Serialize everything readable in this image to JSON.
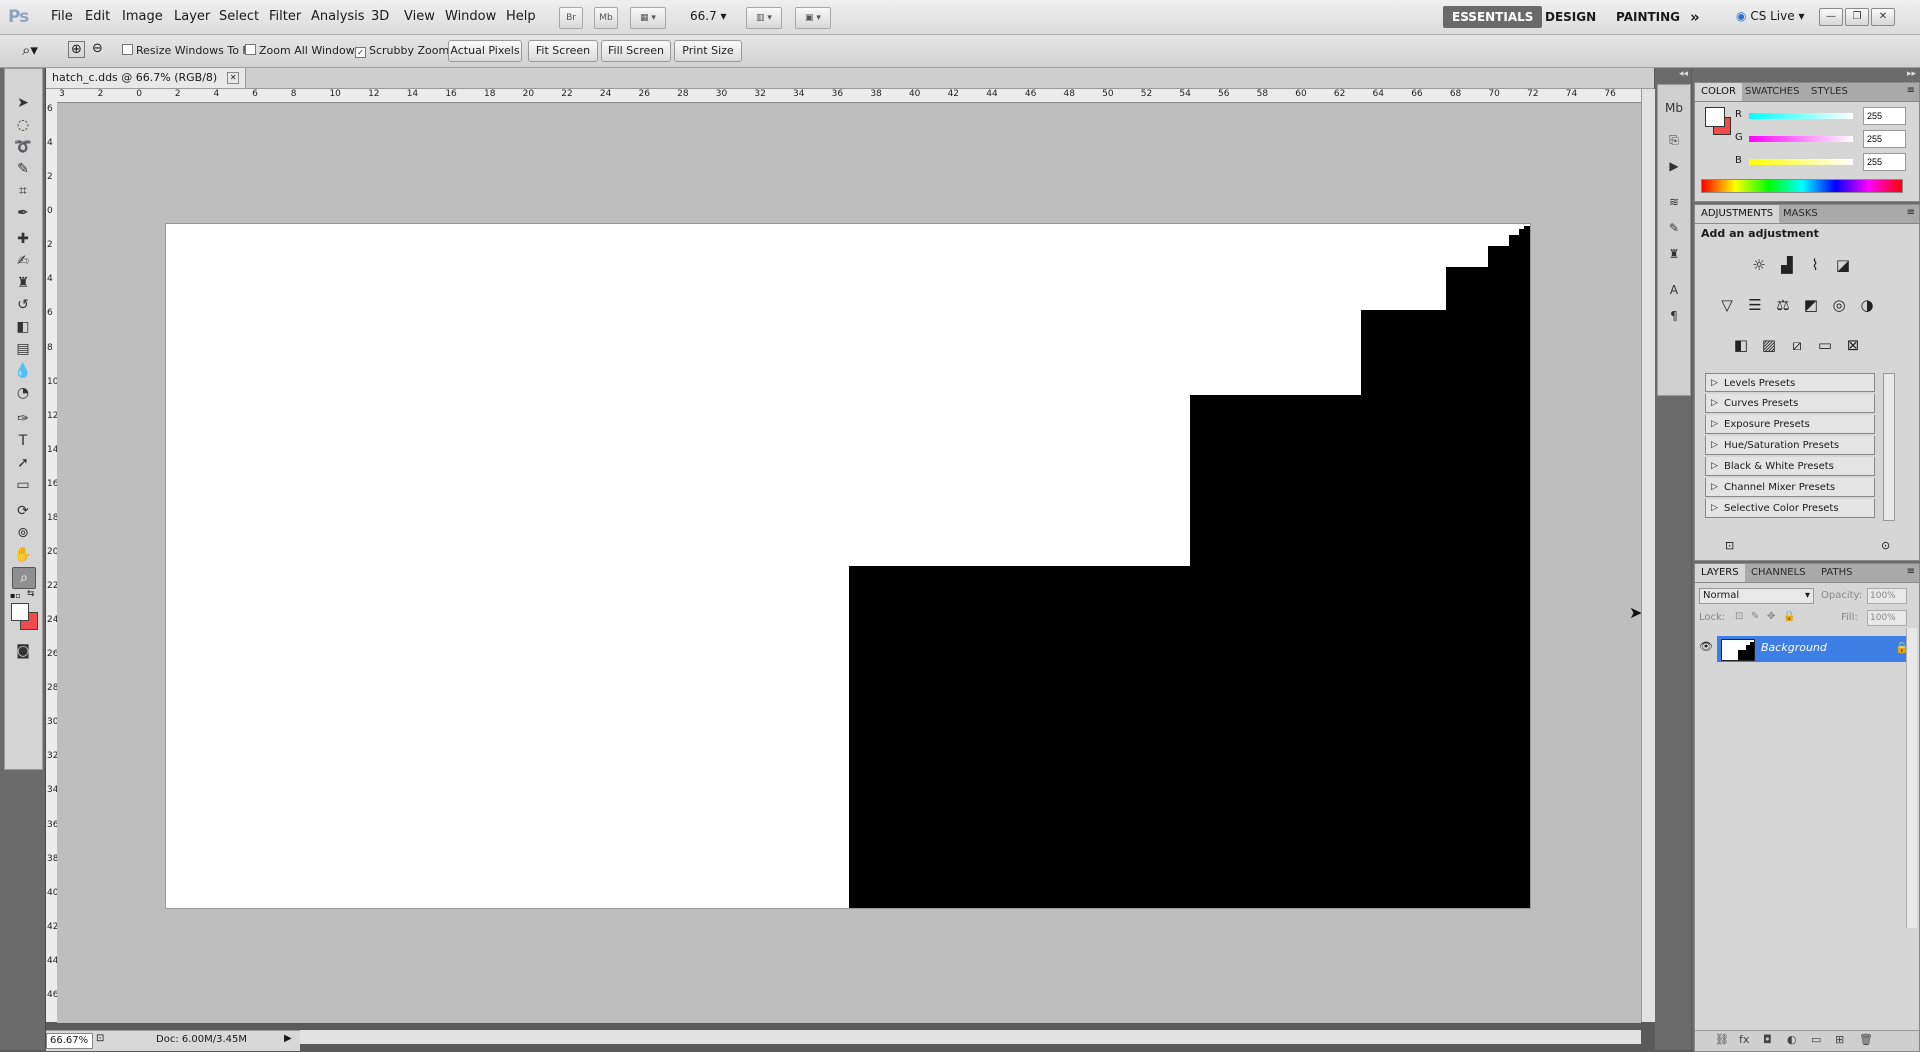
{
  "app": {
    "logo": "Ps"
  },
  "menu": [
    "File",
    "Edit",
    "Image",
    "Layer",
    "Select",
    "Filter",
    "Analysis",
    "3D",
    "View",
    "Window",
    "Help"
  ],
  "menubar_buttons": {
    "bridge": "Br",
    "minibridge": "Mb",
    "zoom_value": "66.7"
  },
  "workspaces": {
    "essentials": "ESSENTIALS",
    "design": "DESIGN",
    "painting": "PAINTING",
    "more": "»",
    "cslive": "CS Live"
  },
  "window_controls": {
    "minimize": "—",
    "restore": "❐",
    "close": "✕"
  },
  "options": {
    "resize_windows": "Resize Windows To Fit",
    "zoom_all": "Zoom All Windows",
    "scrubby": "Scrubby Zoom",
    "actual_pixels": "Actual Pixels",
    "fit_screen": "Fit Screen",
    "fill_screen": "Fill Screen",
    "print_size": "Print Size"
  },
  "document": {
    "tab_title": "hatch_c.dds @ 66.7% (RGB/8)",
    "zoom": "66.67%",
    "doc_size": "Doc: 6.00M/3.45M",
    "ruler_top": [
      "3",
      "2",
      "0",
      "2",
      "4",
      "6",
      "8",
      "10",
      "12",
      "14",
      "16",
      "18",
      "20",
      "22",
      "24",
      "26",
      "28",
      "30",
      "32",
      "34",
      "36",
      "38",
      "40",
      "42",
      "44",
      "46",
      "48",
      "50",
      "52",
      "54",
      "56",
      "58",
      "60",
      "62",
      "64",
      "66",
      "68",
      "70",
      "72",
      "74",
      "76"
    ],
    "ruler_left": [
      "6",
      "4",
      "2",
      "0",
      "2",
      "4",
      "6",
      "8",
      "10",
      "12",
      "14",
      "16",
      "18",
      "20",
      "22",
      "24",
      "26",
      "28",
      "30",
      "32",
      "34",
      "36",
      "38",
      "40",
      "42",
      "44",
      "46"
    ]
  },
  "color_panel": {
    "tabs": [
      "COLOR",
      "SWATCHES",
      "STYLES"
    ],
    "r_label": "R",
    "g_label": "G",
    "b_label": "B",
    "r": "255",
    "g": "255",
    "b": "255",
    "r_color": "#00ffff",
    "g_color": "#ff00ff",
    "b_color": "#ffff00"
  },
  "adjustments_panel": {
    "tabs": [
      "ADJUSTMENTS",
      "MASKS"
    ],
    "title": "Add an adjustment",
    "presets": [
      "Levels Presets",
      "Curves Presets",
      "Exposure Presets",
      "Hue/Saturation Presets",
      "Black & White Presets",
      "Channel Mixer Presets",
      "Selective Color Presets"
    ]
  },
  "layers_panel": {
    "tabs": [
      "LAYERS",
      "CHANNELS",
      "PATHS"
    ],
    "blend_mode": "Normal",
    "opacity_label": "Opacity:",
    "opacity": "100%",
    "lock_label": "Lock:",
    "fill_label": "Fill:",
    "fill": "100%",
    "layer_name": "Background",
    "selection_color": "#3d7fe4"
  },
  "colors": {
    "foreground": "#ffffff",
    "background": "#f04a4a"
  }
}
